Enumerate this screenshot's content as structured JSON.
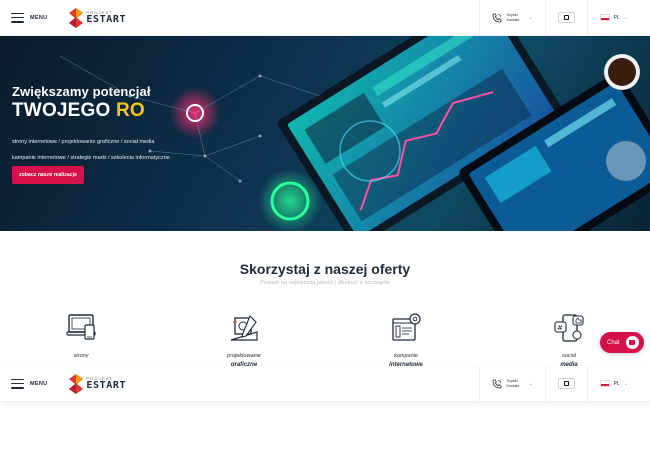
{
  "header": {
    "menu_label": "MENU",
    "logo_small": "PROJEKT",
    "logo_big": "ESTART",
    "contact_label": "Szybki Kontakt",
    "language": "PL"
  },
  "hero": {
    "line1": "Zwiększamy potencjał",
    "line2": "TWOJEGO",
    "line2_accent": "RO",
    "services_line1": "strony internetowe / projektowanie graficzne / social media",
    "services_line2": "kampanie internetowe / strategie marki / szkolenia informatyczne",
    "cta_label": "zobacz nasze realizacje"
  },
  "offer": {
    "title": "Skorzystaj z naszej oferty",
    "subtitle": "Postaw na najwyższą jakość i dbałość o szczegóły",
    "items": [
      {
        "line1": "strony",
        "line2": "",
        "icon": "monitor-icon"
      },
      {
        "line1": "projektowanie",
        "line2": "graficzne",
        "icon": "design-tools-icon"
      },
      {
        "line1": "kampanie",
        "line2": "internetowe",
        "icon": "campaign-icon"
      },
      {
        "line1": "social",
        "line2": "media",
        "icon": "social-media-icon"
      }
    ]
  },
  "chat": {
    "label": "Chat"
  },
  "colors": {
    "accent": "#d6114a",
    "highlight": "#f5c518",
    "text": "#1f2b3a"
  }
}
